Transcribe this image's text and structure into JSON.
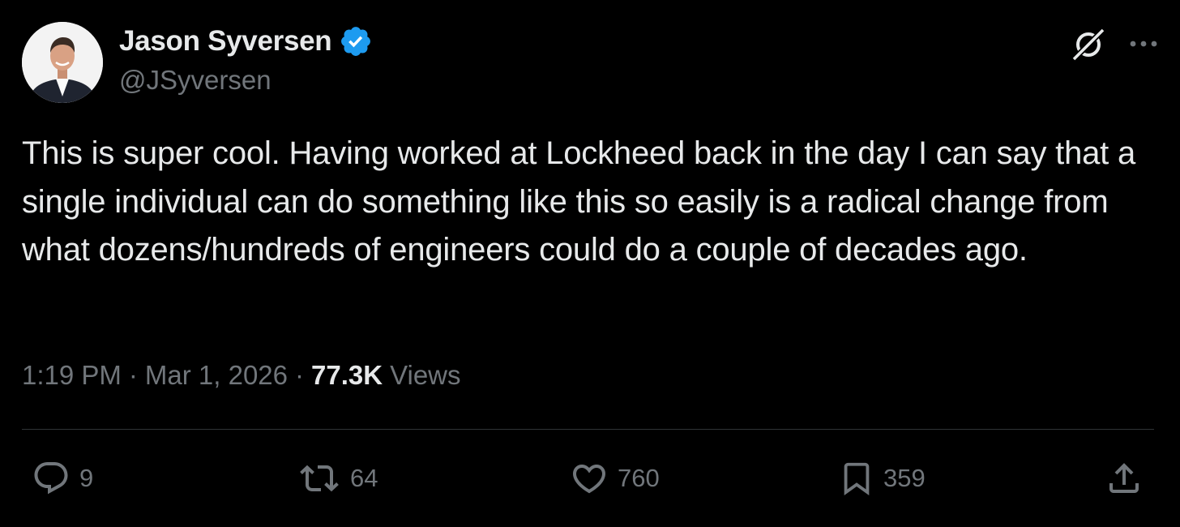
{
  "author": {
    "display_name": "Jason Syversen",
    "handle": "@JSyversen",
    "verified": true,
    "verified_color": "#1d9bf0"
  },
  "tweet": {
    "text": "This is super cool. Having worked at Lockheed back in the day I can say that a single individual can do something like this so easily is a radical change from what dozens/hundreds of engineers could do a couple of decades ago.",
    "time": "1:19 PM",
    "separator": "·",
    "date": "Mar 1, 2026",
    "views_count": "77.3K",
    "views_label": "Views"
  },
  "actions": {
    "replies": "9",
    "reposts": "64",
    "likes": "760",
    "bookmarks": "359"
  },
  "icons": {
    "header": [
      "grok-icon",
      "more-icon"
    ],
    "actions": [
      "reply-icon",
      "repost-icon",
      "like-icon",
      "bookmark-icon",
      "share-icon"
    ]
  },
  "colors": {
    "background": "#000000",
    "primary_text": "#e7e9ea",
    "secondary_text": "#71767b",
    "divider": "#2f3336"
  }
}
